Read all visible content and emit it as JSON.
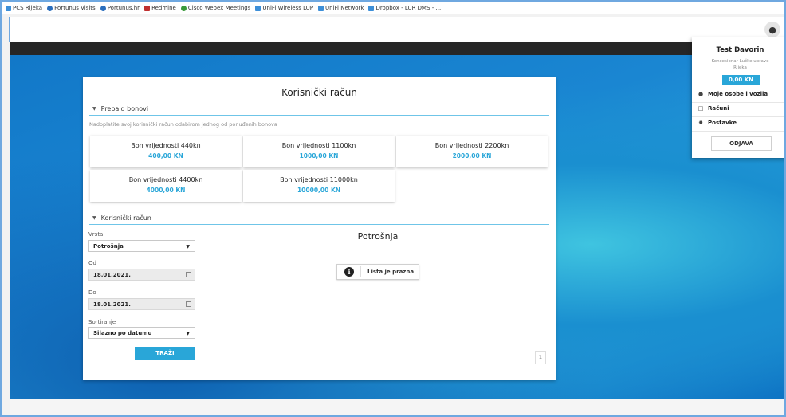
{
  "bookmarks": [
    {
      "label": "PCS Rijeka",
      "icon": "globe-icon"
    },
    {
      "label": "Portunus Visits",
      "icon": "portunus-icon"
    },
    {
      "label": "Portunus.hr",
      "icon": "portunus-icon"
    },
    {
      "label": "Redmine",
      "icon": "redmine-icon"
    },
    {
      "label": "Cisco Webex Meetings",
      "icon": "webex-icon"
    },
    {
      "label": "UniFi Wireless LUP",
      "icon": "unifi-icon"
    },
    {
      "label": "UniFi Network",
      "icon": "unifi-icon"
    },
    {
      "label": "Dropbox - LUR DMS - ...",
      "icon": "dropbox-icon"
    }
  ],
  "account": {
    "title": "Korisnički račun",
    "prepaid_section": "Prepaid bonovi",
    "hint": "Nadoplatite svoj korisnički račun odabirom jednog od ponuđenih bonova",
    "vouchers": [
      {
        "name": "Bon vrijednosti 440kn",
        "price": "400,00 KN"
      },
      {
        "name": "Bon vrijednosti 1100kn",
        "price": "1000,00 KN"
      },
      {
        "name": "Bon vrijednosti 2200kn",
        "price": "2000,00 KN"
      },
      {
        "name": "Bon vrijednosti 4400kn",
        "price": "4000,00 KN"
      },
      {
        "name": "Bon vrijednosti 11000kn",
        "price": "10000,00 KN"
      }
    ],
    "account_section": "Korisnički račun"
  },
  "filters": {
    "type_label": "Vrsta",
    "type_value": "Potrošnja",
    "from_label": "Od",
    "from_value": "18.01.2021.",
    "to_label": "Do",
    "to_value": "18.01.2021.",
    "sort_label": "Sortiranje",
    "sort_value": "Silazno po datumu",
    "search_button": "TRAŽI"
  },
  "consumption": {
    "title": "Potrošnja",
    "empty_text": "Lista je prazna",
    "page": "1"
  },
  "user_menu": {
    "name": "Test Davorin",
    "org_line1": "Koncesionar Lučke uprave",
    "org_line2": "Rijeka",
    "balance": "0,00 KN",
    "items": [
      {
        "label": "Moje osobe i vozila",
        "icon": "person-icon"
      },
      {
        "label": "Računi",
        "icon": "document-icon"
      },
      {
        "label": "Postavke",
        "icon": "gear-icon"
      }
    ],
    "logout": "ODJAVA"
  },
  "colors": {
    "accent": "#29a6d8",
    "dark_bar": "#262626",
    "ocean": "#1a86d2"
  }
}
